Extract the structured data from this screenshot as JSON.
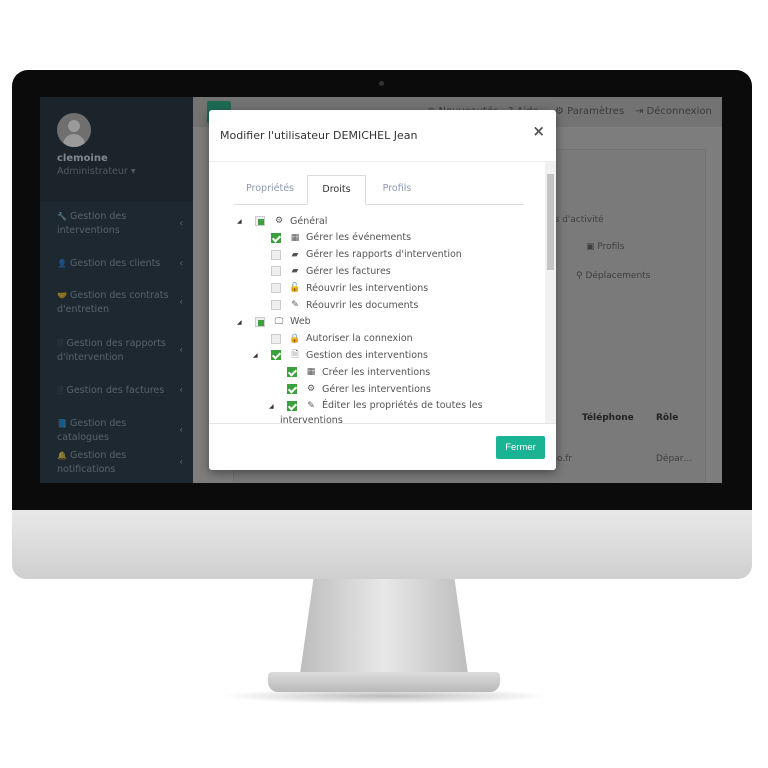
{
  "sidebar": {
    "user": "clemoine",
    "role": "Administrateur ▾",
    "items": [
      {
        "icon": "wrench-icon",
        "glyph": "🔧",
        "label": "Gestion des interventions"
      },
      {
        "icon": "user-icon",
        "glyph": "👤",
        "label": "Gestion des clients"
      },
      {
        "icon": "handshake-icon",
        "glyph": "🤝",
        "label": "Gestion des contrats d'entretien"
      },
      {
        "icon": "file-icon",
        "glyph": "🗎",
        "label": "Gestion des rapports d'intervention"
      },
      {
        "icon": "file-icon",
        "glyph": "🗎",
        "label": "Gestion des factures"
      },
      {
        "icon": "book-icon",
        "glyph": "📘",
        "label": "Gestion des catalogues"
      },
      {
        "icon": "bell-icon",
        "glyph": "🔔",
        "label": "Gestion des notifications"
      }
    ]
  },
  "topbar": {
    "news": "⊕ Nouveautés",
    "help": "? Aide",
    "settings": "⚙ Paramètres",
    "logout": "⇥ Déconnexion"
  },
  "background": {
    "activity": "…es d'activité",
    "profils": "▣ Profils",
    "deplacements": "⚲ Déplacements",
    "col_phone": "Téléphone",
    "col_role": "Rôle",
    "cell_email": "…o.fr",
    "cell_role": "Dépar…"
  },
  "modal": {
    "title": "Modifier l'utilisateur DEMICHEL Jean",
    "close": "×",
    "tabs": [
      "Propriétés",
      "Droits",
      "Profils"
    ],
    "active_tab": "Droits",
    "tree": [
      {
        "label": "Général",
        "glyph": "⚙",
        "state": "partial"
      },
      {
        "label": "Gérer les événements",
        "glyph": "▦",
        "state": "checked"
      },
      {
        "label": "Gérer les rapports d'intervention",
        "glyph": "▰",
        "state": "unchecked"
      },
      {
        "label": "Gérer les factures",
        "glyph": "▰",
        "state": "unchecked"
      },
      {
        "label": "Réouvrir les interventions",
        "glyph": "🔓",
        "state": "unchecked"
      },
      {
        "label": "Réouvrir les documents",
        "glyph": "✎",
        "state": "unchecked"
      },
      {
        "label": "Web",
        "glyph": "🖵",
        "state": "partial"
      },
      {
        "label": "Autoriser la connexion",
        "glyph": "🔒",
        "state": "unchecked"
      },
      {
        "label": "Gestion des interventions",
        "glyph": "🗎",
        "state": "checked"
      },
      {
        "label": "Créer les interventions",
        "glyph": "▦",
        "state": "checked"
      },
      {
        "label": "Gérer les interventions",
        "glyph": "⚙",
        "state": "checked"
      },
      {
        "label": "Éditer les propriétés de toutes les",
        "glyph": "✎",
        "state": "checked"
      }
    ],
    "tree_wrap": "interventions",
    "close_button": "Fermer"
  },
  "colors": {
    "accent": "#1ab394",
    "check": "#3ba23b",
    "sidebar": "#1e2830"
  }
}
